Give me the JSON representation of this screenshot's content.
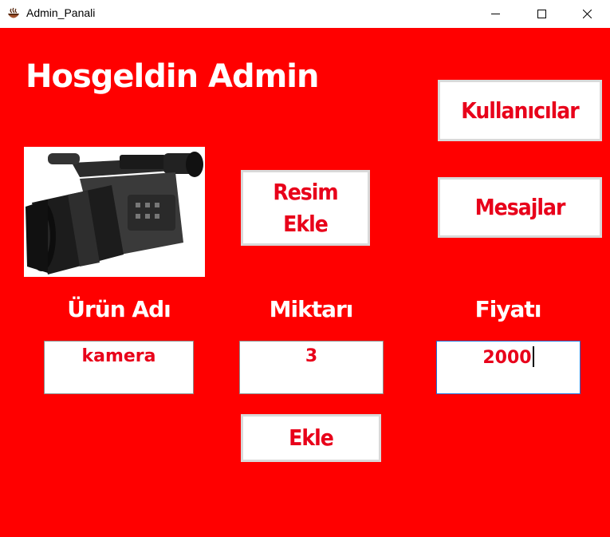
{
  "window": {
    "title": "Admin_Panali"
  },
  "header": {
    "title": "Hosgeldin Admin"
  },
  "buttons": {
    "resim_ekle": "Resim\nEkle",
    "kullanicilar": "Kullanıcılar",
    "mesajlar": "Mesajlar",
    "ekle": "Ekle"
  },
  "form": {
    "urun_adi_label": "Ürün Adı",
    "miktari_label": "Miktarı",
    "fiyati_label": "Fiyatı",
    "urun_adi_value": "kamera",
    "miktari_value": "3",
    "fiyati_value": "2000"
  },
  "colors": {
    "background": "#ff0000",
    "button_text": "#e8001a",
    "focus_border": "#1e6fd9"
  },
  "icons": {
    "app": "java-coffee-icon",
    "product_image": "video-camcorder"
  }
}
